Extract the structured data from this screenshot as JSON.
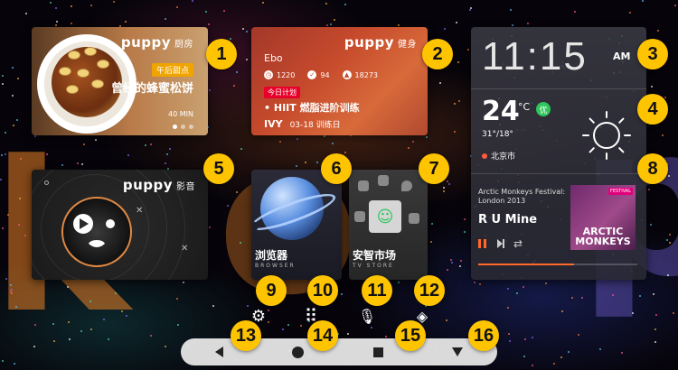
{
  "background": {
    "glyphs": [
      "k",
      "o",
      "p"
    ]
  },
  "badges": [
    "1",
    "2",
    "3",
    "4",
    "5",
    "6",
    "7",
    "8",
    "9",
    "10",
    "11",
    "12",
    "13",
    "14",
    "15",
    "16"
  ],
  "kitchen": {
    "brand": "puppy",
    "brand_sub": "厨房",
    "tag": "午后甜点",
    "title": "曾经的蜂蜜松饼",
    "duration": "40 MIN",
    "pager_total": 3,
    "pager_active": 1
  },
  "fitness": {
    "brand": "puppy",
    "brand_sub": "健身",
    "user": "Ebo",
    "stats": [
      {
        "icon": "clock-icon",
        "value": "1220"
      },
      {
        "icon": "check-icon",
        "value": "94"
      },
      {
        "icon": "flame-icon",
        "value": "18273"
      }
    ],
    "plan_tag": "今日计划",
    "plan": "• HIIT 燃脂进阶训练",
    "coach": "IVY",
    "date": "03-18 训练日"
  },
  "clock": {
    "time": "11:15",
    "ampm": "AM"
  },
  "weather": {
    "temp": "24",
    "unit": "°C",
    "air_quality": "优",
    "range": "31°/18°",
    "city": "北京市",
    "icon": "sun-icon"
  },
  "music": {
    "artist": "Arctic Monkeys Festival: London 2013",
    "song": "R U Mine",
    "album_festival": "FESTIVAL",
    "album_band": "ARCTIC MONKEYS",
    "progress": 0.6,
    "accent": "#ff6a2a"
  },
  "video": {
    "brand": "puppy",
    "brand_sub": "影音"
  },
  "browser": {
    "label": "浏览器",
    "sub": "BROWSER"
  },
  "store": {
    "label": "安智市场",
    "sub": "TV STORE"
  },
  "dock": [
    {
      "name": "settings-icon",
      "glyph": "⚙"
    },
    {
      "name": "apps-grid-icon",
      "glyph": "⠿"
    },
    {
      "name": "microphone-icon",
      "glyph": "🎙"
    },
    {
      "name": "layers-icon",
      "glyph": "◈"
    }
  ],
  "colors": {
    "badge": "#ffc400",
    "kitchen_tag": "#f0a400",
    "plan_tag": "#e8002a",
    "air_quality": "#2ec65a"
  }
}
